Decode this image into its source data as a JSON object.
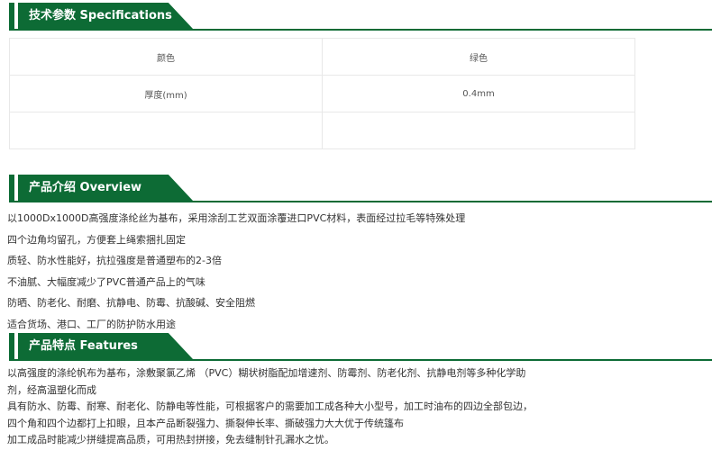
{
  "specifications": {
    "title": "技术参数 Specifications",
    "rows": [
      {
        "label": "颜色",
        "value": "绿色"
      },
      {
        "label": "厚度(mm)",
        "value": "0.4mm"
      },
      {
        "label": "",
        "value": ""
      }
    ]
  },
  "overview": {
    "title": "产品介绍 Overview",
    "lines": [
      "以1000Dx1000D高强度涤纶丝为基布，采用涂刮工艺双面涂覆进口PVC材料，表面经过拉毛等特殊处理",
      "四个边角均留孔，方便套上绳索捆扎固定",
      "质轻、防水性能好，抗拉强度是普通塑布的2-3倍",
      "不油腻、大幅度减少了PVC普通产品上的气味",
      "防晒、防老化、耐磨、抗静电、防霉、抗酸碱、安全阻燃",
      "适合货场、港口、工厂的防护防水用途"
    ]
  },
  "features": {
    "title": "产品特点 Features",
    "lines": [
      "以高强度的涤纶帆布为基布，涂敷聚氯乙烯 （PVC）糊状树脂配加增速剂、防霉剂、防老化剂、抗静电剂等多种化学助",
      "剂，经高温塑化而成",
      "具有防水、防霉、耐寒、耐老化、防静电等性能，可根据客户的需要加工成各种大小型号，加工时油布的四边全部包边，",
      "四个角和四个边都打上扣眼，且本产品断裂强力、撕裂伸长率、撕破强力大大优于传统篷布",
      "加工成品时能减少拼缝提高品质，可用热封拼接，免去缝制针孔漏水之忧。"
    ]
  },
  "colors": {
    "accent": "#0d6b35",
    "text": "#333333",
    "border": "#e8e8e8"
  }
}
